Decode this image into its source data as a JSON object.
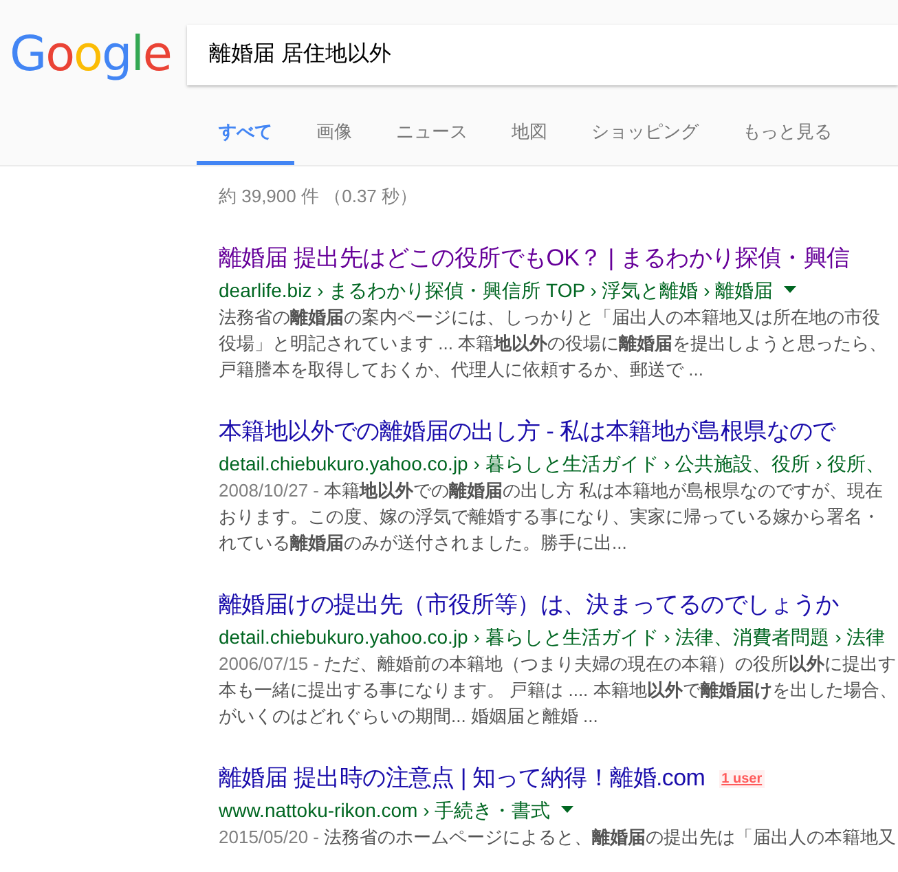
{
  "logo": "Google",
  "search": {
    "value": "離婚届 居住地以外"
  },
  "tabs": [
    {
      "label": "すべて",
      "selected": true
    },
    {
      "label": "画像",
      "selected": false
    },
    {
      "label": "ニュース",
      "selected": false
    },
    {
      "label": "地図",
      "selected": false
    },
    {
      "label": "ショッピング",
      "selected": false
    },
    {
      "label": "もっと見る",
      "selected": false
    }
  ],
  "result_stats": "約 39,900 件 （0.37 秒）",
  "results": [
    {
      "title": "離婚届 提出先はどこの役所でもOK？ | まるわかり探偵・興信",
      "visited": true,
      "url": "dearlife.biz › まるわかり探偵・興信所 TOP › 浮気と離婚 › 離婚届",
      "url_menu": true,
      "lines": [
        "法務省の**離婚届**の案内ページには、しっかりと「届出人の本籍地又は所在地の市役",
        "役場」と明記されています ... 本籍**地以外**の役場に**離婚届**を提出しようと思ったら、",
        "戸籍謄本を取得しておくか、代理人に依頼するか、郵送で ..."
      ]
    },
    {
      "title": "本籍地以外での離婚届の出し方 - 私は本籍地が島根県なので",
      "visited": false,
      "url": "detail.chiebukuro.yahoo.co.jp › 暮らしと生活ガイド › 公共施設、役所 › 役所、",
      "url_menu": false,
      "date": "2008/10/27 - ",
      "lines": [
        "本籍**地以外**での**離婚届**の出し方 私は本籍地が島根県なのですが、現在",
        "おります。この度、嫁の浮気で離婚する事になり、実家に帰っている嫁から署名・",
        "れている**離婚届**のみが送付されました。勝手に出..."
      ]
    },
    {
      "title": "離婚届けの提出先（市役所等）は、決まってるのでしょうか",
      "visited": false,
      "url": "detail.chiebukuro.yahoo.co.jp › 暮らしと生活ガイド › 法律、消費者問題 › 法律",
      "url_menu": false,
      "date": "2006/07/15 - ",
      "lines": [
        "ただ、離婚前の本籍地（つまり夫婦の現在の本籍）の役所**以外**に提出す",
        "本も一緒に提出する事になります。 戸籍は .... 本籍地**以外**で**離婚届け**を出した場合、",
        "がいくのはどれぐらいの期間... 婚姻届と離婚 ..."
      ]
    },
    {
      "title": "離婚届 提出時の注意点 | 知って納得！離婚.com",
      "visited": false,
      "badge": "1 user",
      "url": "www.nattoku-rikon.com › 手続き・書式",
      "url_menu": true,
      "date": "2015/05/20 - ",
      "lines": [
        "法務省のホームページによると、**離婚届**の提出先は「届出人の本籍地又"
      ]
    }
  ]
}
